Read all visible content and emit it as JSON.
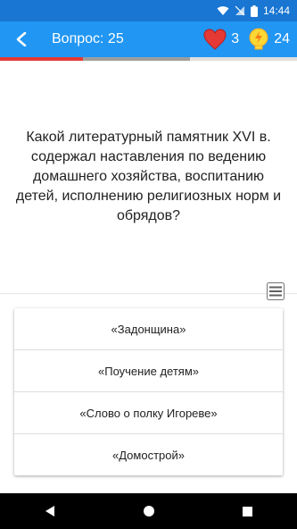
{
  "status_bar": {
    "time": "14:44",
    "icons": [
      "wifi-icon",
      "no-sim-icon",
      "battery-icon"
    ],
    "background": "#1976D2"
  },
  "app_bar": {
    "title": "Вопрос: 25",
    "back_icon": "back-chevron-icon",
    "lives_icon": "heart-icon",
    "lives_count": "3",
    "hints_icon": "lightbulb-icon",
    "hints_count": "24",
    "background": "#2196F3"
  },
  "progress": {
    "fraction": 0.28,
    "shown_fraction": 0.64,
    "color": "#E53935"
  },
  "question": {
    "text": "Какой литературный памятник XVI в. содержал наставления по ведению домашнего хозяйства, воспитанию детей, исполнению религиозных норм и обрядов?"
  },
  "menu_icon": "list-menu-icon",
  "answers": [
    {
      "label": "«Задонщина»"
    },
    {
      "label": "«Поучение детям»"
    },
    {
      "label": "«Слово о полку Игореве»"
    },
    {
      "label": "«Домострой»"
    }
  ],
  "nav_bar": {
    "icons": [
      "back-triangle-icon",
      "home-circle-icon",
      "recents-square-icon"
    ]
  }
}
